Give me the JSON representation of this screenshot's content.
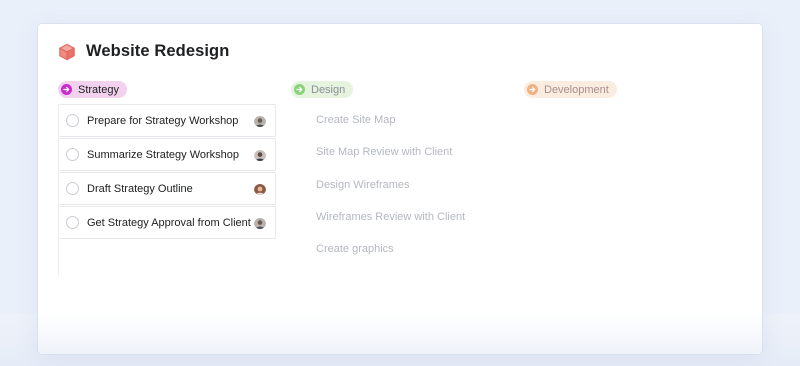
{
  "project": {
    "title": "Website Redesign",
    "icon": "cube-icon",
    "icon_color": "#e8736a"
  },
  "sections": {
    "strategy": {
      "label": "Strategy",
      "icon": "arrow-right-circle-icon",
      "color": "#c92bd0",
      "tasks": [
        {
          "label": "Prepare for Strategy Workshop",
          "assignee": "avatar"
        },
        {
          "label": "Summarize Strategy Workshop",
          "assignee": "avatar"
        },
        {
          "label": "Draft Strategy Outline",
          "assignee": "avatar"
        },
        {
          "label": "Get Strategy Approval from Client",
          "assignee": "avatar"
        }
      ]
    },
    "design": {
      "label": "Design",
      "icon": "arrow-right-circle-icon",
      "color": "#8ad37a",
      "tasks": [
        {
          "label": "Create Site Map"
        },
        {
          "label": "Site Map Review with Client"
        },
        {
          "label": "Design Wireframes"
        },
        {
          "label": "Wireframes Review with Client"
        },
        {
          "label": "Create graphics"
        }
      ]
    },
    "development": {
      "label": "Development",
      "icon": "arrow-right-circle-icon",
      "color": "#f1b183"
    }
  }
}
